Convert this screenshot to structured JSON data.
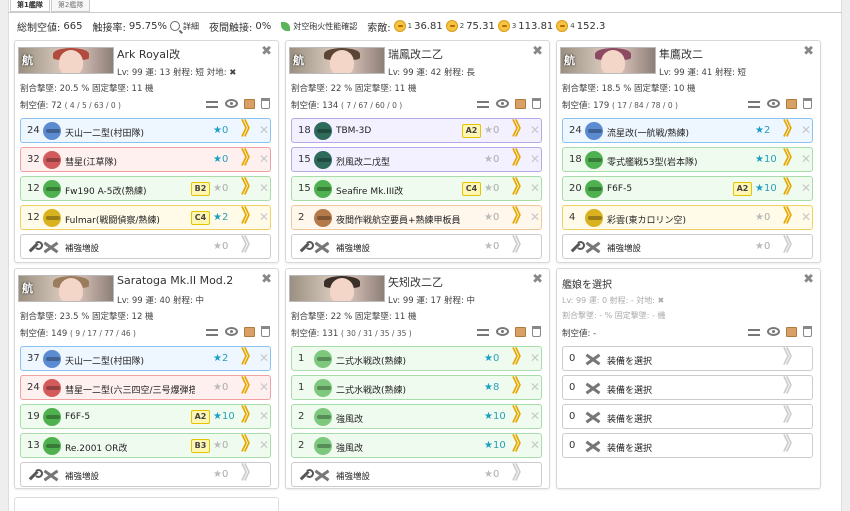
{
  "tabs": [
    "第1艦隊",
    "第2艦隊"
  ],
  "summary": {
    "air_label": "総制空値:",
    "air_value": "665",
    "contact_label": "触接率:",
    "contact_value": "95.75%",
    "detail_label": "詳細",
    "night_label": "夜間触接:",
    "night_value": "0%",
    "aa_check_label": "対空砲火性能確認",
    "enemy_label": "索敵:",
    "los": [
      {
        "lvl": "1",
        "val": "36.81"
      },
      {
        "lvl": "2",
        "val": "75.31"
      },
      {
        "lvl": "3",
        "val": "113.81"
      },
      {
        "lvl": "4",
        "val": "152.3"
      }
    ]
  },
  "ships": [
    {
      "name": "Ark Royal改",
      "kana": "航",
      "meta": "Lv: 99  運: 13  射程: 短  対地: ✖",
      "rates": "割合撃墜: 20.5 %  固定撃墜: 11 機",
      "air_label": "制空値:",
      "air_value": "72",
      "air_detail": "( 4 / 5 / 63 / 0 )",
      "hair": "#b34a3e",
      "slots": [
        {
          "num": "24",
          "icon": "torpedo-bomber-icon",
          "name": "天山一二型(村田隊)",
          "prof": "",
          "star": "0",
          "on": true,
          "color": "c-blue",
          "chev": true
        },
        {
          "num": "32",
          "icon": "dive-bomber-icon",
          "name": "彗星(江草隊)",
          "prof": "",
          "star": "0",
          "on": true,
          "color": "c-red",
          "chev": true
        },
        {
          "num": "12",
          "icon": "fighter-icon",
          "name": "Fw190 A-5改(熟練)",
          "prof": "B2",
          "star": "0",
          "on": false,
          "color": "c-green",
          "chev": true
        },
        {
          "num": "12",
          "icon": "recon-icon",
          "name": "Fulmar(戦闘偵察/熟練)",
          "prof": "C4",
          "star": "2",
          "on": true,
          "color": "c-yellow",
          "chev": true
        }
      ],
      "reinforce": {
        "label": "補強増設",
        "star": "0"
      }
    },
    {
      "name": "瑞鳳改二乙",
      "kana": "航",
      "meta": "Lv: 99  運: 42  射程: 長",
      "rates": "割合撃墜: 22 %  固定撃墜: 11 機",
      "air_label": "制空値:",
      "air_value": "134",
      "air_detail": "( 7 / 67 / 60 / 0 )",
      "hair": "#5b4636",
      "slots": [
        {
          "num": "18",
          "icon": "asw-bomber-icon",
          "name": "TBM-3D",
          "prof": "A2",
          "star": "0",
          "on": false,
          "color": "c-purple",
          "chev": true
        },
        {
          "num": "15",
          "icon": "asw-bomber-icon",
          "name": "烈風改二戊型",
          "prof": "",
          "star": "0",
          "on": false,
          "color": "c-purple",
          "chev": true
        },
        {
          "num": "15",
          "icon": "fighter-icon",
          "name": "Seafire Mk.III改",
          "prof": "C4",
          "star": "0",
          "on": false,
          "color": "c-green",
          "chev": true
        },
        {
          "num": "2",
          "icon": "night-personnel-icon",
          "name": "夜間作戦航空要員+熟練甲板員",
          "prof": "",
          "star": "0",
          "on": false,
          "color": "c-orange",
          "chev": true
        }
      ],
      "reinforce": {
        "label": "補強増設",
        "star": "0"
      }
    },
    {
      "name": "隼鷹改二",
      "kana": "航",
      "meta": "Lv: 99  運: 41  射程: 短",
      "rates": "割合撃墜: 18.5 %  固定撃墜: 10 機",
      "air_label": "制空値:",
      "air_value": "179",
      "air_detail": "( 17 / 84 / 78 / 0 )",
      "hair": "#8e4a62",
      "slots": [
        {
          "num": "24",
          "icon": "torpedo-bomber-icon",
          "name": "流星改(一航戦/熟練)",
          "prof": "",
          "star": "2",
          "on": true,
          "color": "c-blue",
          "chev": true
        },
        {
          "num": "18",
          "icon": "fighter-icon",
          "name": "零式艦戦53型(岩本隊)",
          "prof": "",
          "star": "10",
          "on": true,
          "color": "c-green",
          "chev": true
        },
        {
          "num": "20",
          "icon": "fighter-icon",
          "name": "F6F-5",
          "prof": "A2",
          "star": "10",
          "on": true,
          "color": "c-green",
          "chev": true
        },
        {
          "num": "4",
          "icon": "recon-icon",
          "name": "彩雲(東カロリン空)",
          "prof": "",
          "star": "0",
          "on": false,
          "color": "c-yellow",
          "chev": true
        }
      ],
      "reinforce": {
        "label": "補強増設",
        "star": "0"
      }
    },
    {
      "name": "Saratoga Mk.II Mod.2",
      "kana": "航",
      "meta": "Lv: 99  運: 40  射程: 中",
      "rates": "割合撃墜: 23.5 %  固定撃墜: 12 機",
      "air_label": "制空値:",
      "air_value": "149",
      "air_detail": "( 9 / 17 / 77 / 46 )",
      "hair": "#9b7c5e",
      "slots": [
        {
          "num": "37",
          "icon": "torpedo-bomber-icon",
          "name": "天山一二型(村田隊)",
          "prof": "",
          "star": "2",
          "on": true,
          "color": "c-blue",
          "chev": true
        },
        {
          "num": "24",
          "icon": "dive-bomber-icon",
          "name": "彗星一二型(六三四空/三号爆弾搭…",
          "prof": "",
          "star": "0",
          "on": false,
          "color": "c-red",
          "chev": true
        },
        {
          "num": "19",
          "icon": "fighter-icon",
          "name": "F6F-5",
          "prof": "A2",
          "star": "10",
          "on": true,
          "color": "c-green",
          "chev": true
        },
        {
          "num": "13",
          "icon": "fighter-icon",
          "name": "Re.2001 OR改",
          "prof": "B3",
          "star": "0",
          "on": false,
          "color": "c-green",
          "chev": true
        }
      ],
      "reinforce": {
        "label": "補強増設",
        "star": "0"
      }
    },
    {
      "name": "矢矧改二乙",
      "kana": "",
      "meta": "Lv: 99  運: 17  射程: 中",
      "rates": "割合撃墜: 22 %  固定撃墜: 11 機",
      "air_label": "制空値:",
      "air_value": "131",
      "air_detail": "( 30 / 31 / 35 / 35 )",
      "hair": "#3b2f2a",
      "slots": [
        {
          "num": "1",
          "icon": "seaplane-fighter-icon",
          "name": "二式水戦改(熟練)",
          "prof": "",
          "star": "0",
          "on": true,
          "color": "c-green",
          "chev": true
        },
        {
          "num": "1",
          "icon": "seaplane-fighter-icon",
          "name": "二式水戦改(熟練)",
          "prof": "",
          "star": "8",
          "on": true,
          "color": "c-green",
          "chev": true
        },
        {
          "num": "2",
          "icon": "seaplane-fighter-icon",
          "name": "強風改",
          "prof": "",
          "star": "10",
          "on": true,
          "color": "c-green",
          "chev": true
        },
        {
          "num": "2",
          "icon": "seaplane-fighter-icon",
          "name": "強風改",
          "prof": "",
          "star": "10",
          "on": true,
          "color": "c-green",
          "chev": true
        }
      ],
      "reinforce": {
        "label": "補強増設",
        "star": "0"
      }
    }
  ],
  "empty_ship": {
    "title": "艦娘を選択",
    "meta": "Lv: 99  運: 0  射程: -  対地: ✖",
    "rates": "割合撃墜: - %  固定撃墜: - 機",
    "air_label": "制空値:",
    "air_value": "-",
    "slots": [
      {
        "num": "0",
        "label": "装備を選択"
      },
      {
        "num": "0",
        "label": "装備を選択"
      },
      {
        "num": "0",
        "label": "装備を選択"
      },
      {
        "num": "0",
        "label": "装備を選択"
      }
    ]
  },
  "colors": {
    "torpedo-bomber-icon": "#5b8bd1",
    "dive-bomber-icon": "#d45b5b",
    "fighter-icon": "#4fb04f",
    "recon-icon": "#d9b21f",
    "asw-bomber-icon": "#2f6b5b",
    "night-personnel-icon": "#b57a4a",
    "seaplane-fighter-icon": "#7ec87e",
    "accent": "#1aa0c4",
    "chevron": "#e6a800"
  }
}
